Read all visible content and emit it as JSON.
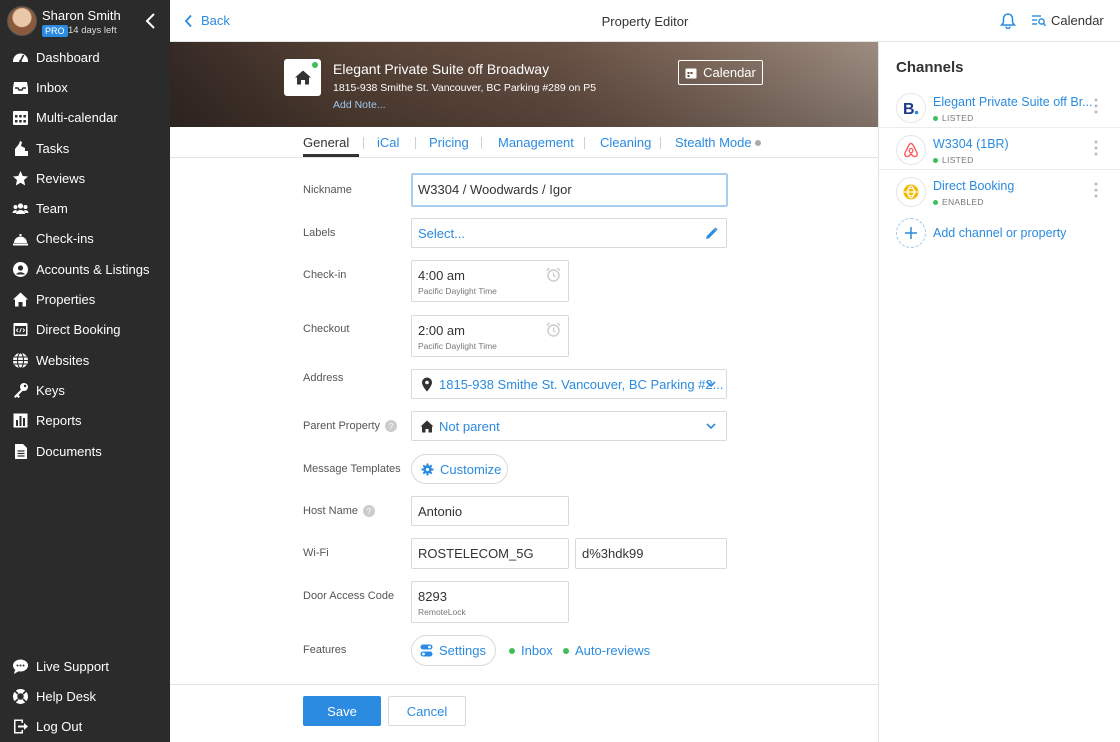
{
  "user": {
    "name": "Sharon Smith",
    "plan": "PRO",
    "trial": "14 days left"
  },
  "nav": [
    {
      "label": "Dashboard",
      "icon": "dashboard-icon"
    },
    {
      "label": "Inbox",
      "icon": "inbox-icon"
    },
    {
      "label": "Multi-calendar",
      "icon": "calendar-grid-icon"
    },
    {
      "label": "Tasks",
      "icon": "tasks-icon"
    },
    {
      "label": "Reviews",
      "icon": "star-icon"
    },
    {
      "label": "Team",
      "icon": "team-icon"
    },
    {
      "label": "Check-ins",
      "icon": "bell-hop-icon"
    },
    {
      "label": "Accounts & Listings",
      "icon": "account-icon"
    },
    {
      "label": "Properties",
      "icon": "home-icon"
    },
    {
      "label": "Direct Booking",
      "icon": "booking-icon"
    },
    {
      "label": "Websites",
      "icon": "globe-icon"
    },
    {
      "label": "Keys",
      "icon": "key-icon"
    },
    {
      "label": "Reports",
      "icon": "reports-icon"
    },
    {
      "label": "Documents",
      "icon": "document-icon"
    }
  ],
  "nav_bottom": [
    {
      "label": "Live Support",
      "icon": "chat-icon"
    },
    {
      "label": "Help Desk",
      "icon": "lifebuoy-icon"
    },
    {
      "label": "Log Out",
      "icon": "logout-icon"
    }
  ],
  "topbar": {
    "back": "Back",
    "title": "Property Editor",
    "calendar": "Calendar"
  },
  "property": {
    "title": "Elegant Private Suite off Broadway",
    "address": "1815-938 Smithe St. Vancouver, BC Parking #289 on P5",
    "add_note": "Add Note...",
    "calendar_button": "Calendar"
  },
  "tabs": [
    "General",
    "iCal",
    "Pricing",
    "Management",
    "Cleaning",
    "Stealth Mode"
  ],
  "form": {
    "nickname_label": "Nickname",
    "nickname": "W3304 / Woodwards / Igor",
    "labels_label": "Labels",
    "labels_placeholder": "Select...",
    "checkin_label": "Check-in",
    "checkin_time": "4:00 am",
    "checkin_tz": "Pacific Daylight Time",
    "checkout_label": "Checkout",
    "checkout_time": "2:00 am",
    "checkout_tz": "Pacific Daylight Time",
    "address_label": "Address",
    "address": "1815-938 Smithe St. Vancouver, BC Parking #2...",
    "parent_label": "Parent Property",
    "parent": "Not parent",
    "templates_label": "Message Templates",
    "customize": "Customize",
    "host_label": "Host Name",
    "host": "Antonio",
    "wifi_label": "Wi-Fi",
    "wifi_name": "ROSTELECOM_5G",
    "wifi_password": "d%3hdk99",
    "door_label": "Door Access Code",
    "door_code": "8293",
    "door_provider": "RemoteLock",
    "features_label": "Features",
    "settings": "Settings",
    "inbox": "Inbox",
    "auto_reviews": "Auto-reviews",
    "help_mark": "?"
  },
  "actions": {
    "save": "Save",
    "cancel": "Cancel"
  },
  "channels": {
    "title": "Channels",
    "items": [
      {
        "name": "Elegant Private Suite off Br...",
        "status": "LISTED",
        "logo": "booking-com-logo"
      },
      {
        "name": "W3304 (1BR)",
        "status": "LISTED",
        "logo": "airbnb-logo"
      },
      {
        "name": "Direct Booking",
        "status": "ENABLED",
        "logo": "direct-booking-logo"
      }
    ],
    "add": "Add channel or property"
  },
  "colors": {
    "accent": "#2a8be0",
    "sidebar": "#2b2b2b",
    "status_green": "#3fbf5a"
  }
}
